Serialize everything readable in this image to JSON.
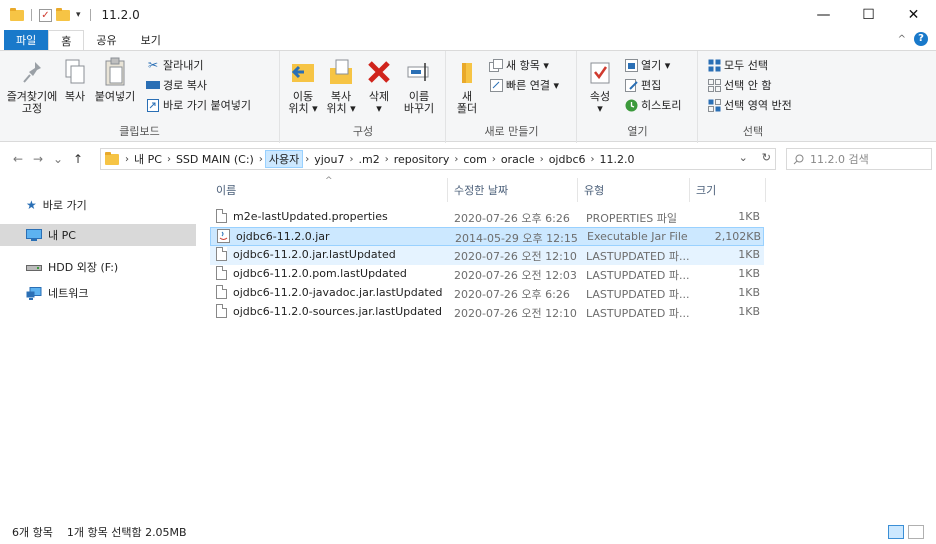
{
  "window": {
    "title": "11.2.0",
    "minimize": "—",
    "maximize": "☐",
    "close": "✕"
  },
  "ribbon_tabs": [
    "파일",
    "홈",
    "공유",
    "보기"
  ],
  "ribbon": {
    "clipboard": {
      "label": "클립보드",
      "pin": "즐겨찾기에\n고정",
      "copy": "복사",
      "paste": "붙여넣기",
      "cut": "잘라내기",
      "copy_path": "경로 복사",
      "paste_shortcut": "바로 가기 붙여넣기"
    },
    "organize": {
      "label": "구성",
      "move_to": "이동\n위치 ▾",
      "copy_to": "복사\n위치 ▾",
      "delete": "삭제\n▾",
      "rename": "이름\n바꾸기"
    },
    "new": {
      "label": "새로 만들기",
      "new_folder": "새\n폴더",
      "new_item": "새 항목 ▾",
      "easy_access": "빠른 연결 ▾"
    },
    "open": {
      "label": "열기",
      "properties": "속성\n▾",
      "open": "열기 ▾",
      "edit": "편집",
      "history": "히스토리"
    },
    "select": {
      "label": "선택",
      "select_all": "모두 선택",
      "select_none": "선택 안 함",
      "invert": "선택 영역 반전"
    }
  },
  "address": {
    "crumbs": [
      "내 PC",
      "SSD MAIN (C:)",
      "사용자",
      "yjou7",
      ".m2",
      "repository",
      "com",
      "oracle",
      "ojdbc6",
      "11.2.0"
    ],
    "highlighted_index": 2,
    "dropdown": "⌄",
    "refresh": "↻",
    "search_placeholder": "11.2.0 검색"
  },
  "nav": {
    "back": "←",
    "forward": "→",
    "recent": "⌄",
    "up": "↑",
    "items": [
      {
        "label": "바로 가기",
        "icon": "star-icon"
      },
      {
        "label": "내 PC",
        "icon": "pc-icon"
      },
      {
        "label": "HDD 외장 (F:)",
        "icon": "drive-icon"
      },
      {
        "label": "네트워크",
        "icon": "network-icon"
      }
    ]
  },
  "columns": {
    "name": "이름",
    "date": "수정한 날짜",
    "type": "유형",
    "size": "크기"
  },
  "files": [
    {
      "name": "m2e-lastUpdated.properties",
      "date": "2020-07-26 오후 6:26",
      "type": "PROPERTIES 파일",
      "size": "1KB",
      "icon": "document-icon"
    },
    {
      "name": "ojdbc6-11.2.0.jar",
      "date": "2014-05-29 오후 12:15",
      "type": "Executable Jar File",
      "size": "2,102KB",
      "icon": "jar-icon"
    },
    {
      "name": "ojdbc6-11.2.0.jar.lastUpdated",
      "date": "2020-07-26 오전 12:10",
      "type": "LASTUPDATED 파...",
      "size": "1KB",
      "icon": "document-icon"
    },
    {
      "name": "ojdbc6-11.2.0.pom.lastUpdated",
      "date": "2020-07-26 오전 12:03",
      "type": "LASTUPDATED 파...",
      "size": "1KB",
      "icon": "document-icon"
    },
    {
      "name": "ojdbc6-11.2.0-javadoc.jar.lastUpdated",
      "date": "2020-07-26 오후 6:26",
      "type": "LASTUPDATED 파...",
      "size": "1KB",
      "icon": "document-icon"
    },
    {
      "name": "ojdbc6-11.2.0-sources.jar.lastUpdated",
      "date": "2020-07-26 오전 12:10",
      "type": "LASTUPDATED 파...",
      "size": "1KB",
      "icon": "document-icon"
    }
  ],
  "selected_index": 1,
  "hover_index": 2,
  "status": {
    "count": "6개 항목",
    "selection": "1개 항목 선택함 2.05MB"
  },
  "colors": {
    "accent": "#1979ca",
    "selection": "#cce8ff",
    "folder": "#f6c445"
  }
}
